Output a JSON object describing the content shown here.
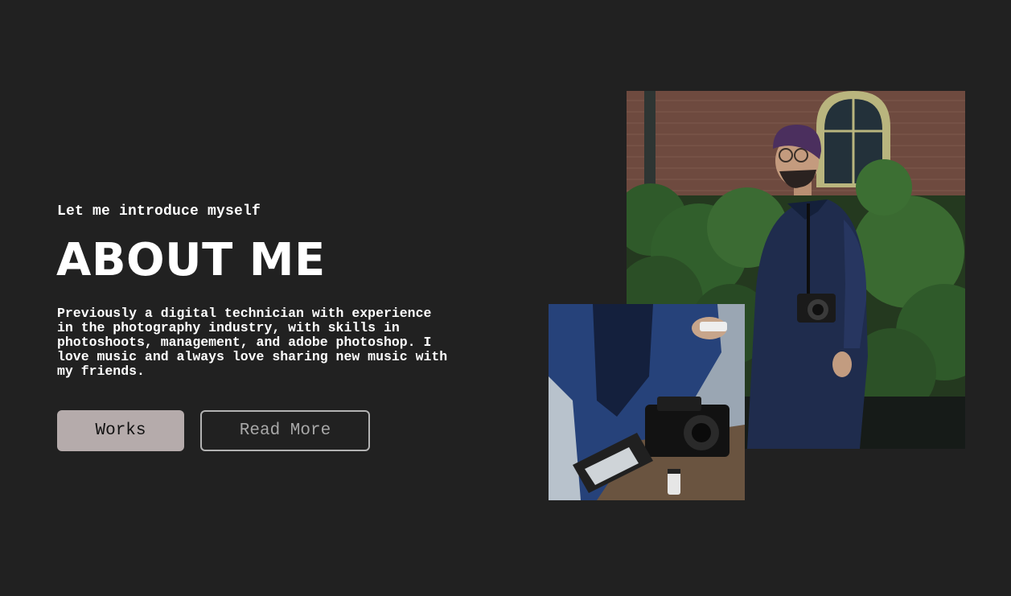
{
  "about": {
    "intro": "Let me introduce myself",
    "title": "ABOUT ME",
    "bio": "Previously a digital technician with experience in the photography industry, with skills in photoshoots, management, and adobe photoshop. I love music and always love sharing new music with my friends."
  },
  "buttons": {
    "works": "Works",
    "read_more": "Read More"
  },
  "photos": {
    "main": "portrait-photo",
    "secondary": "camera-photo"
  },
  "colors": {
    "background": "#212121",
    "primary_button": "#b5abab",
    "text": "#ffffff"
  }
}
